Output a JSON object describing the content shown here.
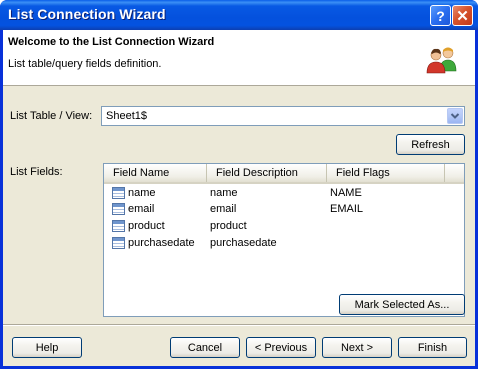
{
  "window": {
    "title": "List Connection Wizard"
  },
  "titlebar_buttons": {
    "help": "?",
    "close": "✕"
  },
  "header": {
    "title": "Welcome to the List Connection Wizard",
    "subtitle": "List table/query fields definition."
  },
  "table_view": {
    "label": "List Table / View:",
    "value": "Sheet1$"
  },
  "refresh_button": "Refresh",
  "fields": {
    "label": "List Fields:",
    "columns": [
      "Field Name",
      "Field Description",
      "Field Flags"
    ],
    "rows": [
      {
        "name": "name",
        "description": "name",
        "flags": "NAME"
      },
      {
        "name": "email",
        "description": "email",
        "flags": "EMAIL"
      },
      {
        "name": "product",
        "description": "product",
        "flags": ""
      },
      {
        "name": "purchasedate",
        "description": "purchasedate",
        "flags": ""
      }
    ]
  },
  "mark_selected_button": "Mark Selected As...",
  "footer": {
    "help": "Help",
    "cancel": "Cancel",
    "previous": "< Previous",
    "next": "Next >",
    "finish": "Finish"
  },
  "colors": {
    "titlebar": "#0451dd",
    "dialog_background": "#ece9d8",
    "button_border": "#003c74"
  }
}
